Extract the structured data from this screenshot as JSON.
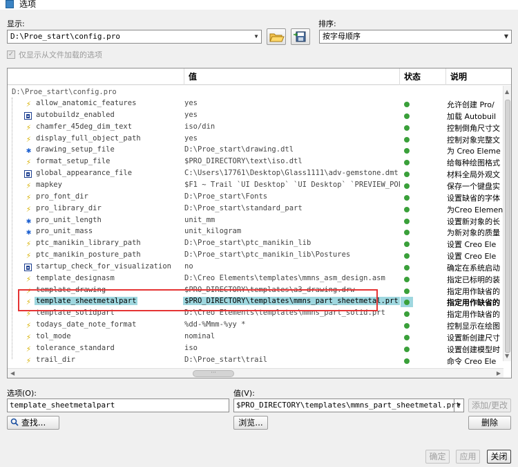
{
  "window": {
    "title": "选项"
  },
  "display": {
    "label": "显示:",
    "value": "D:\\Proe_start\\config.pro"
  },
  "sort": {
    "label": "排序:",
    "value": "按字母顺序"
  },
  "only_loaded": {
    "label": "仅显示从文件加载的选项",
    "checked": true
  },
  "table": {
    "headers": {
      "value": "值",
      "status": "状态",
      "desc": "说明"
    },
    "root": "D:\\Proe_start\\config.pro",
    "rows": [
      {
        "name": "allow_anatomic_features",
        "value": "yes",
        "desc": "允许创建 Pro/",
        "icon": "bolt-icon"
      },
      {
        "name": "autobuildz_enabled",
        "value": "yes",
        "desc": "加载 Autobuil",
        "icon": "grid-icon"
      },
      {
        "name": "chamfer_45deg_dim_text",
        "value": "iso/din",
        "desc": "控制倒角尺寸文",
        "icon": "bolt-icon"
      },
      {
        "name": "display_full_object_path",
        "value": "yes",
        "desc": "控制对象完整文",
        "icon": "bolt-icon"
      },
      {
        "name": "drawing_setup_file",
        "value": "D:\\Proe_start\\drawing.dtl",
        "desc": "为 Creo Eleme",
        "icon": "star-icon"
      },
      {
        "name": "format_setup_file",
        "value": "$PRO_DIRECTORY\\text\\iso.dtl",
        "desc": "给每种绘图格式",
        "icon": "bolt-icon"
      },
      {
        "name": "global_appearance_file",
        "value": "C:\\Users\\17761\\Desktop\\Glass1111\\adv-gemstone.dmt",
        "desc": "材料全局外观文",
        "icon": "grid-icon"
      },
      {
        "name": "mapkey",
        "value": "$F1 ~ Trail `UI Desktop` `UI Desktop` `PREVIEW_POPUP...",
        "desc": "保存一个键盘实",
        "icon": "bolt-icon"
      },
      {
        "name": "pro_font_dir",
        "value": "D:\\Proe_start\\Fonts",
        "desc": "设置缺省的字体",
        "icon": "bolt-icon"
      },
      {
        "name": "pro_library_dir",
        "value": "D:\\Proe_start\\standard_part",
        "desc": "为Creo Elemen",
        "icon": "bolt-icon"
      },
      {
        "name": "pro_unit_length",
        "value": "unit_mm",
        "desc": "设置新对象的长",
        "icon": "star-icon"
      },
      {
        "name": "pro_unit_mass",
        "value": "unit_kilogram",
        "desc": "为新对象的质量",
        "icon": "star-icon"
      },
      {
        "name": "ptc_manikin_library_path",
        "value": "D:\\Proe_start\\ptc_manikin_lib",
        "desc": "设置 Creo Ele",
        "icon": "bolt-icon"
      },
      {
        "name": "ptc_manikin_posture_path",
        "value": "D:\\Proe_start\\ptc_manikin_lib\\Postures",
        "desc": "设置 Creo Ele",
        "icon": "bolt-icon"
      },
      {
        "name": "startup_check_for_visualization",
        "value": "no",
        "desc": "确定在系统启动",
        "icon": "grid-icon"
      },
      {
        "name": "template_designasm",
        "value": "D:\\Creo Elements\\templates\\mmns_asm_design.asm",
        "desc": "指定已标明的装",
        "icon": "bolt-icon"
      },
      {
        "name": "template_drawing",
        "value": "$PRO_DIRECTORY\\templates\\a3_drawing.drw",
        "desc": "指定用作缺省的",
        "icon": "bolt-icon"
      },
      {
        "name": "template_sheetmetalpart",
        "value": "$PRO_DIRECTORY\\templates\\mmns_part_sheetmetal.prt",
        "desc": "指定用作缺省的",
        "icon": "bolt-icon",
        "selected": true
      },
      {
        "name": "template_solidpart",
        "value": "D:\\Creo Elements\\templates\\mmns_part_solid.prt",
        "desc": "指定用作缺省的",
        "icon": "bolt-icon"
      },
      {
        "name": "todays_date_note_format",
        "value": "%dd-%Mmm-%yy *",
        "desc": "控制显示在绘图",
        "icon": "bolt-icon"
      },
      {
        "name": "tol_mode",
        "value": "nominal",
        "desc": "设置新创建尺寸",
        "icon": "bolt-icon"
      },
      {
        "name": "tolerance_standard",
        "value": "iso",
        "desc": "设置创建模型时",
        "icon": "bolt-icon"
      },
      {
        "name": "trail_dir",
        "value": "D:\\Proe_start\\trail",
        "desc": "命令 Creo Ele",
        "icon": "bolt-icon"
      }
    ]
  },
  "option_field": {
    "label": "选项(O):",
    "value": "template_sheetmetalpart"
  },
  "value_field": {
    "label": "值(V):",
    "value": "$PRO_DIRECTORY\\templates\\mmns_part_sheetmetal.prt"
  },
  "buttons": {
    "find": "查找...",
    "browse": "浏览...",
    "add_change": "添加/更改",
    "delete": "删除",
    "ok": "确定",
    "apply": "应用",
    "close": "关闭"
  },
  "colors": {
    "selection": "#9fd7df",
    "highlight_box": "#e53333",
    "status_dot": "#3aa03a"
  }
}
